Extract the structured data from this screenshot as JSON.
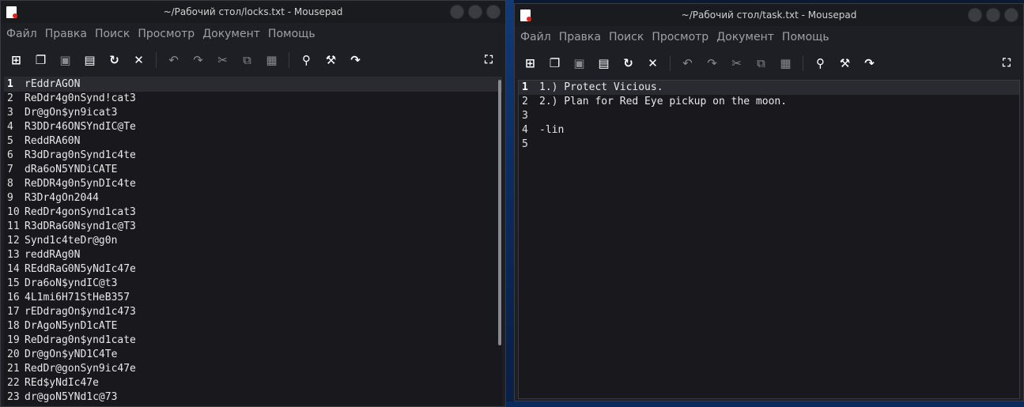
{
  "menu": [
    "Файл",
    "Правка",
    "Поиск",
    "Просмотр",
    "Документ",
    "Помощь"
  ],
  "toolbar_icons": [
    "new-file-icon",
    "new-window-icon",
    "save-icon",
    "save-as-icon",
    "reload-icon",
    "close-icon",
    "undo-icon",
    "redo-icon",
    "cut-icon",
    "copy-icon",
    "paste-icon",
    "find-icon",
    "find-replace-icon",
    "goto-line-icon",
    "fullscreen-icon"
  ],
  "left_window": {
    "title": "~/Рабочий стол/locks.txt - Mousepad",
    "lines": [
      {
        "n": "1",
        "t": "rEddrAGON"
      },
      {
        "n": "2",
        "t": "ReDdr4g0nSynd!cat3"
      },
      {
        "n": "3",
        "t": "Dr@gOn$yn9icat3"
      },
      {
        "n": "4",
        "t": "R3DDr46ONSYndIC@Te"
      },
      {
        "n": "5",
        "t": "ReddRA60N"
      },
      {
        "n": "6",
        "t": "R3dDrag0nSynd1c4te"
      },
      {
        "n": "7",
        "t": "dRa6oN5YNDiCATE"
      },
      {
        "n": "8",
        "t": "ReDDR4g0n5ynDIc4te"
      },
      {
        "n": "9",
        "t": "R3Dr4gOn2044"
      },
      {
        "n": "10",
        "t": "RedDr4gonSynd1cat3"
      },
      {
        "n": "11",
        "t": "R3dDRaG0Nsynd1c@T3"
      },
      {
        "n": "12",
        "t": "Synd1c4teDr@g0n"
      },
      {
        "n": "13",
        "t": "reddRAg0N"
      },
      {
        "n": "14",
        "t": "REddRaG0N5yNdIc47e"
      },
      {
        "n": "15",
        "t": "Dra6oN$yndIC@t3"
      },
      {
        "n": "16",
        "t": "4L1mi6H71StHeB357"
      },
      {
        "n": "17",
        "t": "rEDdragOn$ynd1c473"
      },
      {
        "n": "18",
        "t": "DrAgoN5ynD1cATE"
      },
      {
        "n": "19",
        "t": "ReDdrag0n$ynd1cate"
      },
      {
        "n": "20",
        "t": "Dr@gOn$yND1C4Te"
      },
      {
        "n": "21",
        "t": "RedDr@gonSyn9ic47e"
      },
      {
        "n": "22",
        "t": "REd$yNdIc47e"
      },
      {
        "n": "23",
        "t": "dr@goN5YNd1c@73"
      }
    ]
  },
  "right_window": {
    "title": "~/Рабочий стол/task.txt - Mousepad",
    "lines": [
      {
        "n": "1",
        "t": "1.) Protect Vicious."
      },
      {
        "n": "2",
        "t": "2.) Plan for Red Eye pickup on the moon."
      },
      {
        "n": "3",
        "t": ""
      },
      {
        "n": "4",
        "t": "-lin"
      },
      {
        "n": "5",
        "t": ""
      }
    ]
  },
  "colors": {
    "window_bg": "#1e1f24",
    "editor_bg": "#19191d",
    "current_line": "#2a2b30",
    "desktop": "#0b2a5c"
  }
}
